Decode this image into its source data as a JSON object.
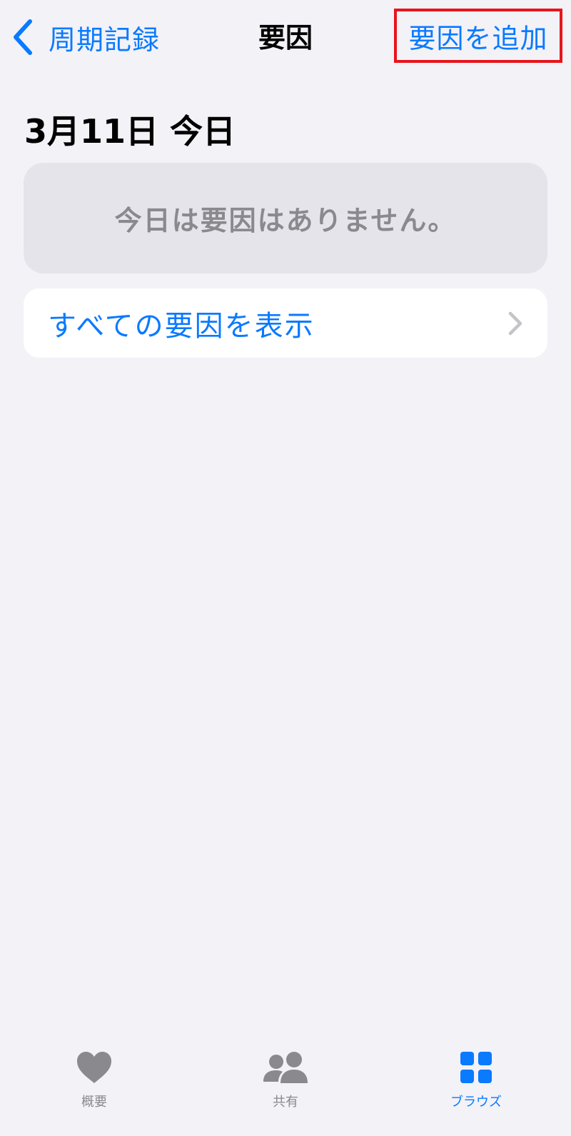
{
  "nav": {
    "back_label": "周期記録",
    "title": "要因",
    "add_label": "要因を追加"
  },
  "main": {
    "date_heading": "3月11日 今日",
    "empty_message": "今日は要因はありません。",
    "show_all_label": "すべての要因を表示"
  },
  "tabs": [
    {
      "label": "概要",
      "icon": "heart-icon",
      "active": false
    },
    {
      "label": "共有",
      "icon": "people-icon",
      "active": false
    },
    {
      "label": "ブラウズ",
      "icon": "grid-icon",
      "active": true
    }
  ],
  "colors": {
    "accent": "#0a7aff",
    "background": "#f2f2f7",
    "highlight_border": "#e8141b",
    "inactive": "#8a8a8e"
  }
}
